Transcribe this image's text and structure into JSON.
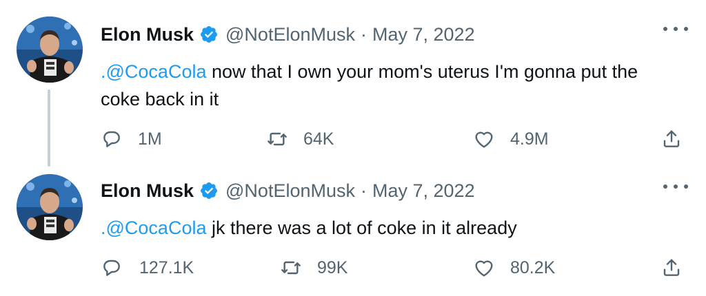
{
  "tweets": [
    {
      "author": {
        "name": "Elon Musk",
        "handle": "@NotElonMusk",
        "date": "May 7, 2022"
      },
      "mention": ".@CocaCola",
      "text": " now that I own your mom's uterus I'm gonna put the coke back in it",
      "stats": {
        "replies": "1M",
        "retweets": "64K",
        "likes": "4.9M"
      }
    },
    {
      "author": {
        "name": "Elon Musk",
        "handle": "@NotElonMusk",
        "date": "May 7, 2022"
      },
      "mention": ".@CocaCola",
      "text": " jk there was a lot of coke in it already",
      "stats": {
        "replies": "127.1K",
        "retweets": "99K",
        "likes": "80.2K"
      }
    }
  ],
  "separator": "·",
  "icons": {
    "verified": "verified-badge-icon",
    "more": "more-options-icon",
    "reply": "reply-icon",
    "retweet": "retweet-icon",
    "like": "like-icon",
    "share": "share-icon"
  },
  "colors": {
    "accent": "#1d9bf0",
    "text": "#0f1419",
    "muted": "#536471",
    "thread_line": "#c4cfd6"
  }
}
